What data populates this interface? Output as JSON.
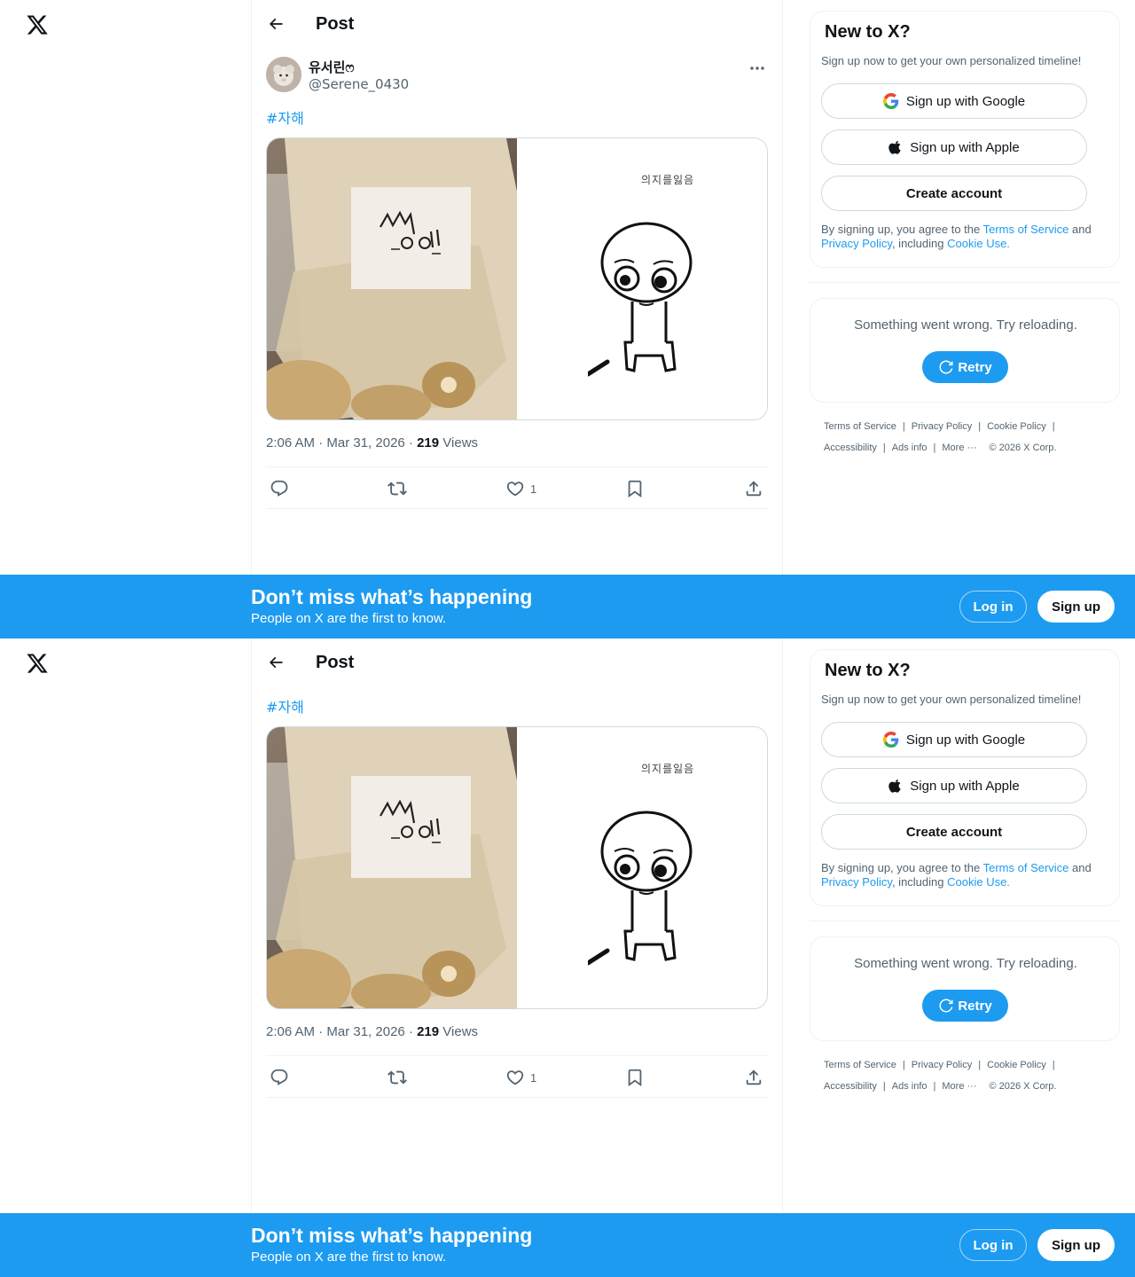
{
  "header": {
    "title": "Post"
  },
  "post": {
    "display_name": "유서린ෆ",
    "handle": "@Serene_0430",
    "hashtag": "#자해",
    "image_caption": "의지를잃음",
    "time": "2:06 AM · Mar 31, 2026 · ",
    "views_count": "219",
    "views_label": " Views",
    "like_count": "1"
  },
  "signup_card": {
    "title": "New to X?",
    "subtitle": "Sign up now to get your own personalized timeline!",
    "google_label": "Sign up with Google",
    "apple_label": "Sign up with Apple",
    "create_label": "Create account",
    "legal_prefix": "By signing up, you agree to the ",
    "terms_link": "Terms of Service",
    "legal_and": " and ",
    "privacy_link": "Privacy Policy",
    "legal_including": ", including ",
    "cookie_link": "Cookie Use."
  },
  "trends_card": {
    "error_text": "Something went wrong. Try reloading.",
    "retry_label": "Retry"
  },
  "footer": {
    "terms": "Terms of Service",
    "privacy": "Privacy Policy",
    "cookie": "Cookie Policy",
    "accessibility": "Accessibility",
    "ads": "Ads info",
    "more": "More",
    "copyright": "© 2026 X Corp."
  },
  "banner": {
    "title": "Don’t miss what’s happening",
    "subtitle": "People on X are the first to know.",
    "login_label": "Log in",
    "signup_label": "Sign up"
  },
  "colors": {
    "accent": "#1d9bf0",
    "text_secondary": "#536471",
    "border": "#eff3f4"
  }
}
